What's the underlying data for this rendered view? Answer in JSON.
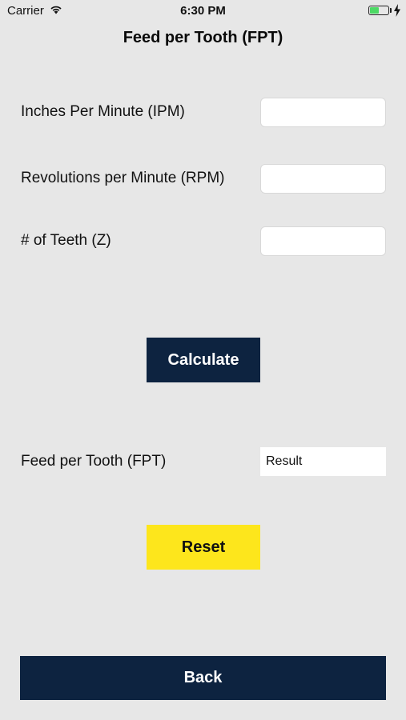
{
  "status_bar": {
    "carrier": "Carrier",
    "time": "6:30 PM",
    "wifi_icon": "wifi-icon",
    "battery_icon": "battery-icon",
    "charging_icon": "bolt-icon",
    "battery_color": "#4cd964"
  },
  "header": {
    "title": "Feed per Tooth (FPT)"
  },
  "form": {
    "ipm_label": "Inches Per Minute (IPM)",
    "ipm_value": "",
    "rpm_label": "Revolutions per Minute (RPM)",
    "rpm_value": "",
    "teeth_label": "# of Teeth (Z)",
    "teeth_value": ""
  },
  "actions": {
    "calculate_label": "Calculate",
    "reset_label": "Reset",
    "back_label": "Back"
  },
  "result": {
    "label": "Feed per Tooth (FPT)",
    "value": "Result"
  },
  "colors": {
    "background": "#e7e7e7",
    "navy": "#0d2340",
    "yellow": "#fde61c"
  }
}
